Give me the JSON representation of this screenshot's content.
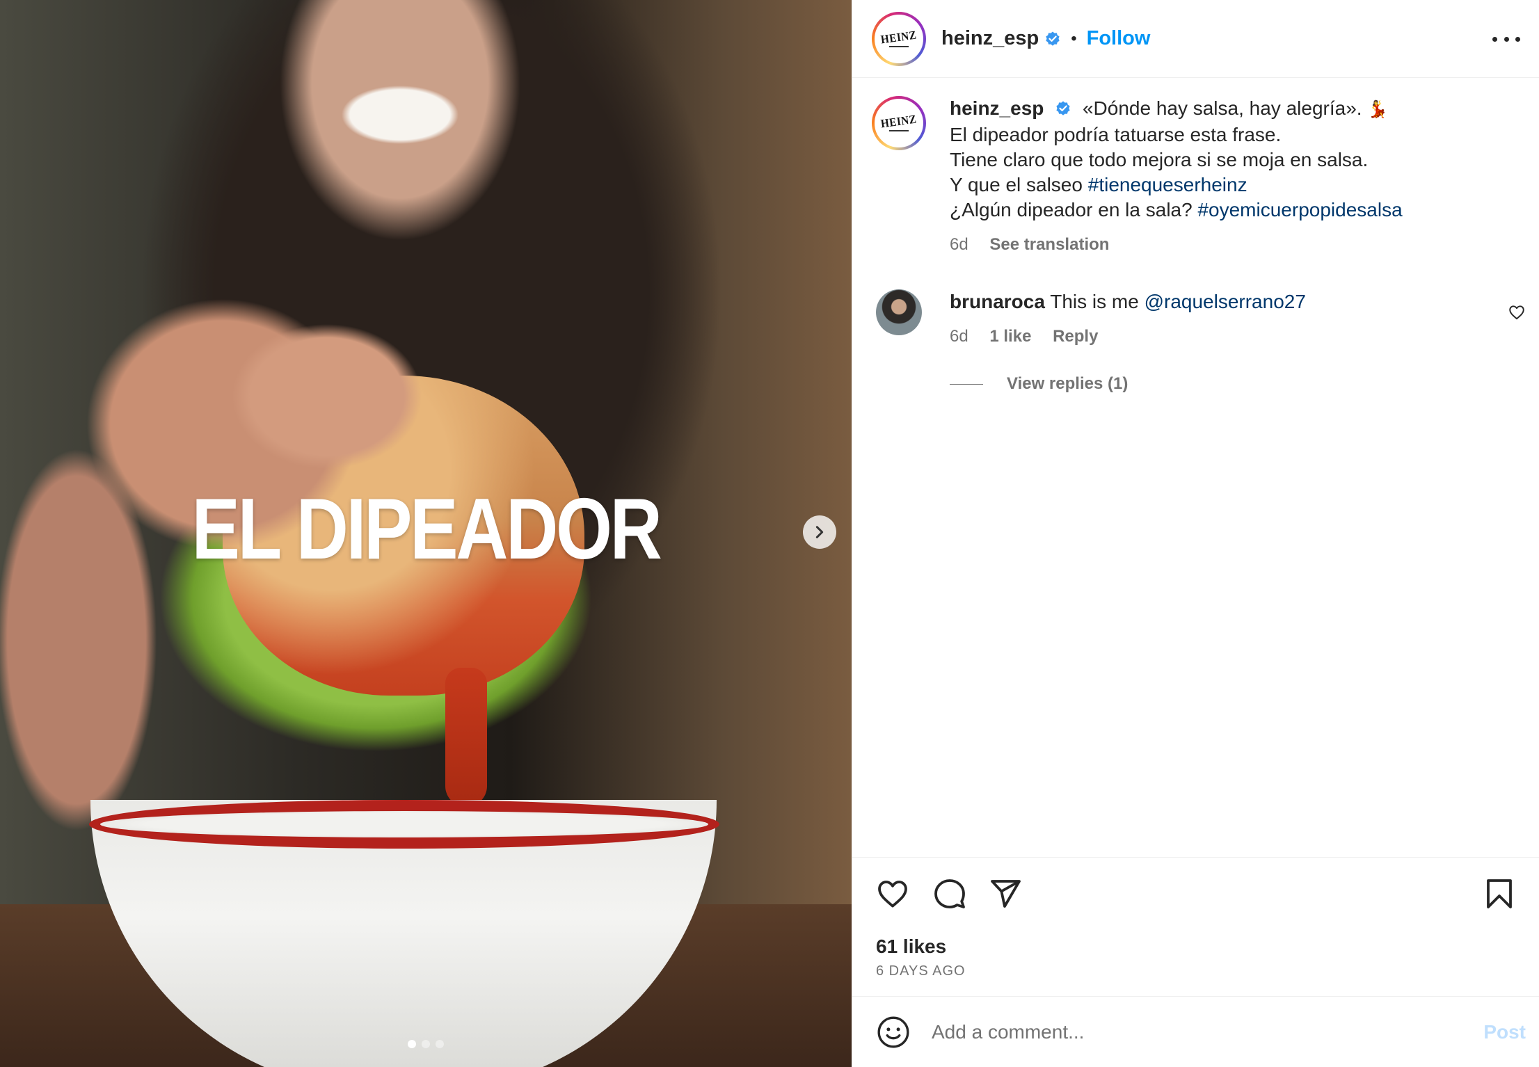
{
  "media": {
    "overlay_title": "EL DIPEADOR",
    "slide_count": 3,
    "active_slide": 1,
    "next_icon": "chevron-right-icon"
  },
  "header": {
    "avatar_logo": "HEINZ",
    "username": "heinz_esp",
    "verified_icon": "verified-badge-icon",
    "separator": "•",
    "follow_label": "Follow",
    "more_icon": "more-options-icon"
  },
  "caption": {
    "avatar_logo": "HEINZ",
    "username": "heinz_esp",
    "line1": "«Dónde hay salsa, hay alegría».",
    "line1_emoji": "💃",
    "line2": "El dipeador podría tatuarse esta frase.",
    "line3": "Tiene claro que todo mejora si se moja en salsa.",
    "line4_text": "Y que el salseo",
    "line4_tag": "#tienequeserheinz",
    "line5_text": "¿Algún dipeador en la sala?",
    "line5_tag": "#oyemicuerpopidesalsa",
    "time": "6d",
    "see_translation": "See translation"
  },
  "comment": {
    "username": "brunaroca",
    "text": "This is me",
    "mention": "@raquelserrano27",
    "time": "6d",
    "likes": "1 like",
    "reply": "Reply",
    "view_replies": "View replies (1)",
    "heart_icon": "heart-outline-icon"
  },
  "actions": {
    "icons": [
      "heart-icon",
      "comment-icon",
      "share-icon",
      "bookmark-icon"
    ],
    "likes_count": "61 likes",
    "posted_ago": "6 DAYS AGO"
  },
  "add_comment": {
    "emoji_icon": "smiley-icon",
    "placeholder": "Add a comment...",
    "post_label": "Post"
  },
  "colors": {
    "link_blue": "#0095f6",
    "hashtag": "#00376b",
    "muted": "#737373",
    "post_disabled": "#c0dffd"
  }
}
